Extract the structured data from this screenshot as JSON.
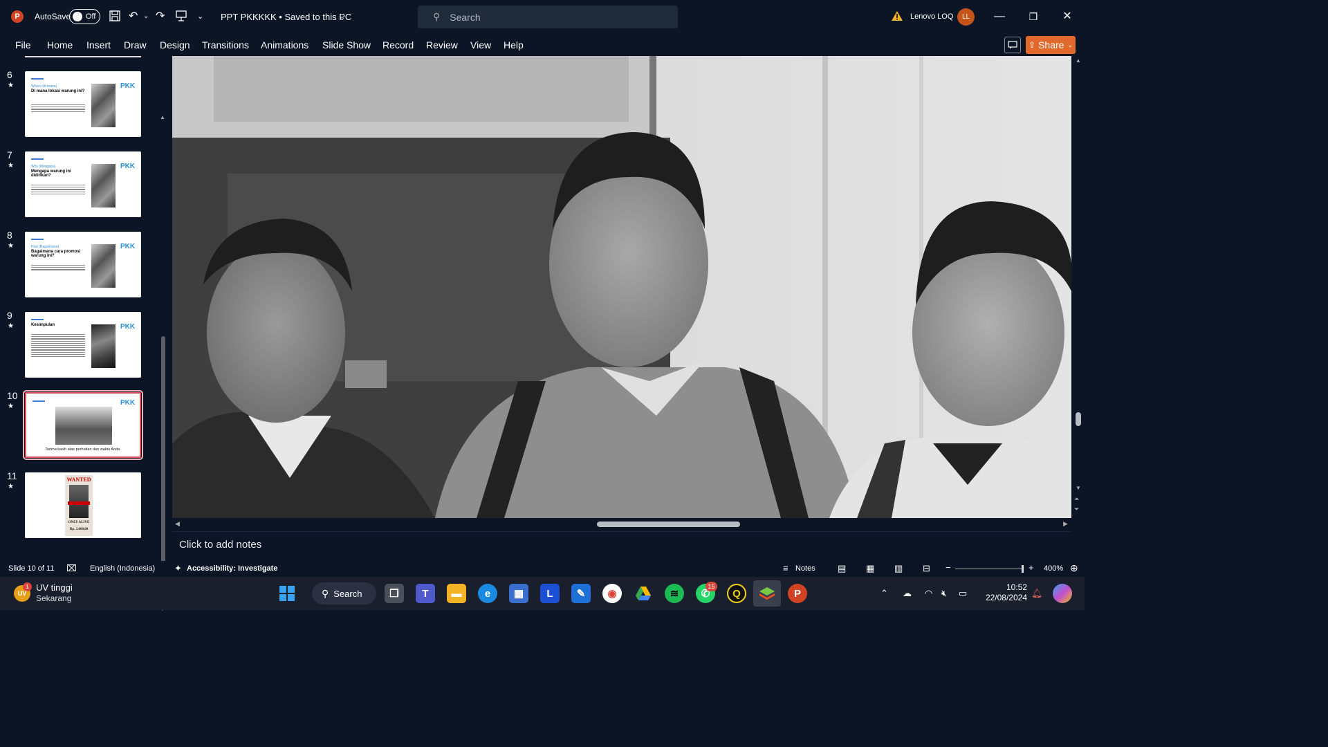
{
  "titlebar": {
    "autosave_label": "AutoSave",
    "autosave_state": "Off",
    "doc_title": "PPT PKKKKK • Saved to this PC",
    "search_placeholder": "Search",
    "user_name": "Lenovo LOQ",
    "user_initials": "LL"
  },
  "ribbon": {
    "tabs": [
      "File",
      "Home",
      "Insert",
      "Draw",
      "Design",
      "Transitions",
      "Animations",
      "Slide Show",
      "Record",
      "Review",
      "View",
      "Help"
    ],
    "share_label": "Share"
  },
  "thumbnails": [
    {
      "num": "6",
      "sub": "Where (di mana)",
      "head": "Di mana lokasi warung ini?",
      "logo": "PKK"
    },
    {
      "num": "7",
      "sub": "Why (Mengapa)",
      "head": "Mengapa warung ini didirikan?",
      "logo": "PKK"
    },
    {
      "num": "8",
      "sub": "How (Bagaimana)",
      "head": "Bagaimana cara promosi warung ini?",
      "logo": "PKK"
    },
    {
      "num": "9",
      "sub": "",
      "head": "Kesimpulan",
      "logo": "PKK"
    },
    {
      "num": "10",
      "caption": "Terima kasih atas perhatian dan waktu Anda.",
      "logo": "PKK"
    },
    {
      "num": "11",
      "wanted": "WANTED",
      "wanted_caption": "ONLY ALIVE",
      "reward": "Rp. 2.000,00"
    }
  ],
  "notes_placeholder": "Click to add notes",
  "status": {
    "slide": "Slide 10 of 11",
    "language": "English (Indonesia)",
    "accessibility": "Accessibility: Investigate",
    "notes": "Notes",
    "zoom": "400%"
  },
  "taskbar": {
    "weather_title": "UV tinggi",
    "weather_sub": "Sekarang",
    "weather_badge": "1",
    "weather_initials": "UV",
    "search_label": "Search",
    "whatsapp_badge": "15",
    "time": "10:52",
    "date": "22/08/2024"
  }
}
